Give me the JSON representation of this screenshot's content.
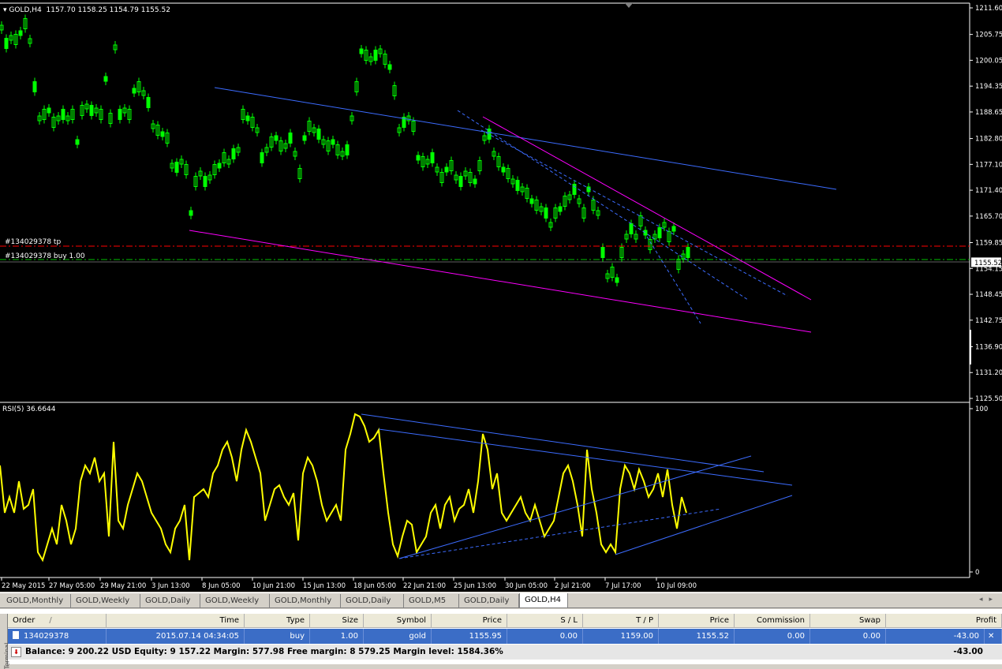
{
  "window": {
    "chart_title": "GOLD,H4",
    "ohlc": "1157.70 1158.25 1154.79 1155.52",
    "indicator_title": "RSI(5) 36.6644",
    "current_price_label": "1155.52",
    "tp_label": "#134029378 tp",
    "buy_label": "#134029378 buy 1.00"
  },
  "price_axis_labels": [
    "1211.60",
    "1205.75",
    "1200.05",
    "1194.35",
    "1188.65",
    "1182.80",
    "1177.10",
    "1171.40",
    "1165.70",
    "1159.85",
    "1154.15",
    "1148.45",
    "1142.75",
    "1136.90",
    "1131.20",
    "1125.50"
  ],
  "rsi_axis_labels": [
    "100",
    "0"
  ],
  "time_axis_labels": [
    "22 May 2015",
    "27 May 05:00",
    "29 May 21:00",
    "3 Jun 13:00",
    "8 Jun 05:00",
    "10 Jun 21:00",
    "15 Jun 13:00",
    "18 Jun 05:00",
    "22 Jun 21:00",
    "25 Jun 13:00",
    "30 Jun 05:00",
    "2 Jul 21:00",
    "7 Jul 17:00",
    "10 Jul 09:00"
  ],
  "tabs": [
    {
      "label": "GOLD,Monthly",
      "active": false
    },
    {
      "label": "GOLD,Weekly",
      "active": false
    },
    {
      "label": "GOLD,Daily",
      "active": false
    },
    {
      "label": "GOLD,Weekly",
      "active": false
    },
    {
      "label": "GOLD,Monthly",
      "active": false
    },
    {
      "label": "GOLD,Daily",
      "active": false
    },
    {
      "label": "GOLD,M5",
      "active": false
    },
    {
      "label": "GOLD,Daily",
      "active": false
    },
    {
      "label": "GOLD,H4",
      "active": true
    }
  ],
  "terminal": {
    "side_label": "Terminal",
    "columns": [
      "Order",
      "/",
      "Time",
      "Type",
      "Size",
      "Symbol",
      "Price",
      "S / L",
      "T / P",
      "Price",
      "Commission",
      "Swap",
      "Profit"
    ],
    "order": {
      "id": "134029378",
      "time": "2015.07.14 04:34:05",
      "type": "buy",
      "size": "1.00",
      "symbol": "gold",
      "price": "1155.95",
      "sl": "0.00",
      "tp": "1159.00",
      "cur_price": "1155.52",
      "commission": "0.00",
      "swap": "0.00",
      "profit": "-43.00"
    },
    "balance_text": "Balance: 9 200.22 USD  Equity: 9 157.22  Margin: 577.98  Free margin: 8 579.25  Margin level: 1584.36%",
    "balance_profit": "-43.00"
  },
  "colors": {
    "background": "#000000",
    "candles": "#00ff00",
    "rsi": "#ffff00",
    "trendline_blue": "#3c6cff",
    "trendline_magenta": "#ff00ff",
    "tp_line": "#ff0000",
    "buy_line": "#00c000",
    "selected_row": "#3b6dc6"
  },
  "icons": {
    "order_icon": "document-icon",
    "balance_icon": "arrow-down-icon"
  }
}
